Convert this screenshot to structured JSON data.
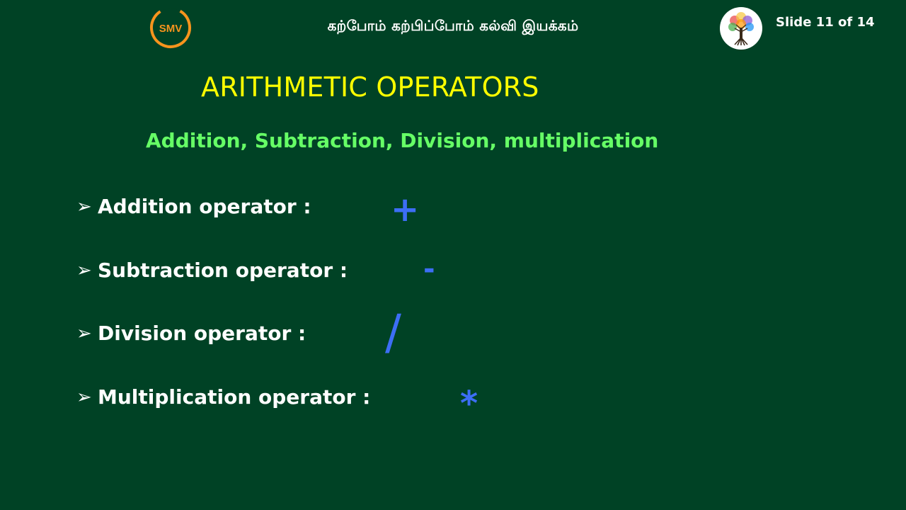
{
  "header": {
    "left_logo_text": "SMV",
    "tagline": "கற்போம் கற்பிப்போம் கல்வி இயக்கம்",
    "slide_counter": "Slide 11 of 14",
    "left_logo_icon": "smv-logo-icon",
    "right_logo_icon": "tree-logo-icon"
  },
  "slide": {
    "title": "ARITHMETIC OPERATORS",
    "subtitle": "Addition, Subtraction, Division, multiplication",
    "bullet_glyph": "➢",
    "operators": [
      {
        "label": "Addition operator :",
        "symbol": "+"
      },
      {
        "label": "Subtraction operator :",
        "symbol": "-"
      },
      {
        "label": "Division operator :",
        "symbol": "/"
      },
      {
        "label": "Multiplication operator :",
        "symbol": "*"
      }
    ]
  },
  "colors": {
    "background": "#004225",
    "title": "#ffff00",
    "subtitle": "#66ff66",
    "text": "#ffffff",
    "symbol": "#3d6ef5",
    "logo_orange": "#f7941d"
  }
}
